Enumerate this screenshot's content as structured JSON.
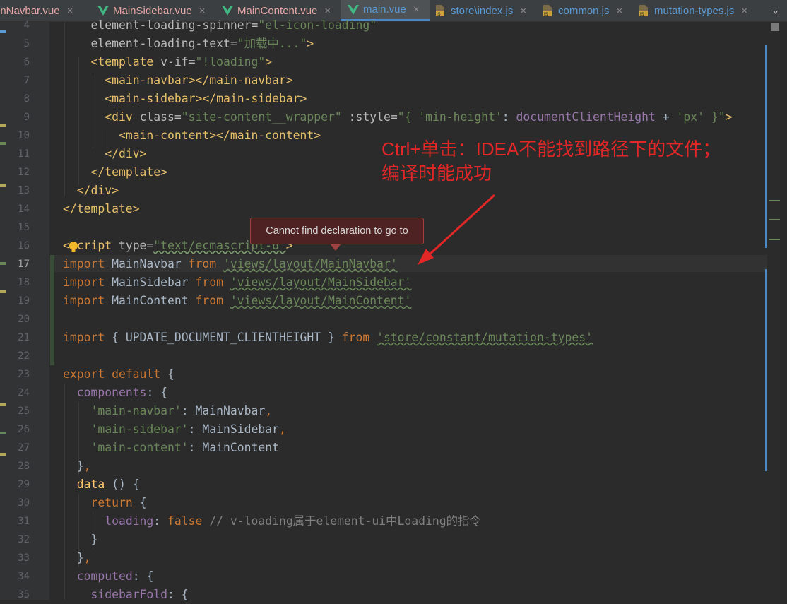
{
  "tabs": [
    {
      "label": "inNavbar.vue",
      "icon": "vue-icon",
      "color": "#e8a7a7",
      "active": false
    },
    {
      "label": "MainSidebar.vue",
      "icon": "vue-icon",
      "color": "#e8a7a7",
      "active": false
    },
    {
      "label": "MainContent.vue",
      "icon": "vue-icon",
      "color": "#e8a7a7",
      "active": false
    },
    {
      "label": "main.vue",
      "icon": "vue-icon",
      "color": "#5a9bd6",
      "active": true
    },
    {
      "label": "store\\index.js",
      "icon": "js-icon",
      "color": "#5a9bd6",
      "active": false
    },
    {
      "label": "common.js",
      "icon": "js-icon",
      "color": "#5a9bd6",
      "active": false
    },
    {
      "label": "mutation-types.js",
      "icon": "js-icon",
      "color": "#5a9bd6",
      "active": false
    }
  ],
  "tab_close_glyph": "×",
  "tab_menu_glyph": "⌄",
  "line_numbers": [
    "4",
    "5",
    "6",
    "7",
    "8",
    "9",
    "10",
    "11",
    "12",
    "13",
    "14",
    "15",
    "16",
    "17",
    "18",
    "19",
    "20",
    "21",
    "22",
    "23",
    "24",
    "25",
    "26",
    "27",
    "28",
    "29",
    "30",
    "31",
    "32",
    "33",
    "34",
    "35"
  ],
  "current_line": "17",
  "code": {
    "l4": [
      "element-loading-spinner=",
      "\"el-icon-loading\""
    ],
    "l5": [
      "element-loading-text=",
      "\"加载中...\"",
      ">"
    ],
    "l6": [
      "<template ",
      "v-if=",
      "\"!loading\"",
      ">"
    ],
    "l7": "<main-navbar></main-navbar>",
    "l8": "<main-sidebar></main-sidebar>",
    "l9": [
      "<div ",
      "class=",
      "\"site-content__wrapper\"",
      " :style=",
      "\"{ ",
      "'min-height'",
      ": ",
      "documentClientHeight",
      " + ",
      "'px'",
      " }\"",
      ">"
    ],
    "l10": "<main-content></main-content>",
    "l11": "</div>",
    "l12": "</template>",
    "l13": "</div>",
    "l14": "</template>",
    "l16": [
      "<",
      "script ",
      "type=",
      "\"text/ecmascript-6\"",
      ">"
    ],
    "l17": [
      "import ",
      "MainNavbar ",
      "from ",
      "'views/layout/MainNavbar'"
    ],
    "l18": [
      "import ",
      "MainSidebar ",
      "from ",
      "'views/layout/MainSidebar'"
    ],
    "l19": [
      "import ",
      "MainContent ",
      "from ",
      "'views/layout/MainContent'"
    ],
    "l21": [
      "import ",
      "{ UPDATE_DOCUMENT_CLIENTHEIGHT } ",
      "from ",
      "'store/constant/mutation-types'"
    ],
    "l23": [
      "export ",
      "default ",
      "{"
    ],
    "l24": [
      "components",
      ": {"
    ],
    "l25": [
      "'main-navbar'",
      ": MainNavbar",
      ","
    ],
    "l26": [
      "'main-sidebar'",
      ": MainSidebar",
      ","
    ],
    "l27": [
      "'main-content'",
      ": MainContent"
    ],
    "l28": [
      "}",
      ","
    ],
    "l29": [
      "data ",
      "() {"
    ],
    "l30": [
      "return ",
      "{"
    ],
    "l31": [
      "loading",
      ": ",
      "false ",
      "// v-loading属于element-ui中Loading的指令"
    ],
    "l32": "}",
    "l33": [
      "}",
      ","
    ],
    "l34": [
      "computed",
      ": {"
    ],
    "l35": [
      "sidebarFold",
      ": {"
    ]
  },
  "tooltip": "Cannot find declaration to go to",
  "annotation": [
    "Ctrl+单击：IDEA不能找到路径下的文件；",
    "编译时能成功"
  ],
  "colors": {
    "background": "#2b2b2b",
    "gutter": "#313335",
    "tag": "#e8bf6a",
    "string": "#6a8759",
    "keyword": "#cc7832",
    "property": "#9876aa",
    "annotation": "#e32626",
    "tooltip_bg": "#4e2222"
  }
}
